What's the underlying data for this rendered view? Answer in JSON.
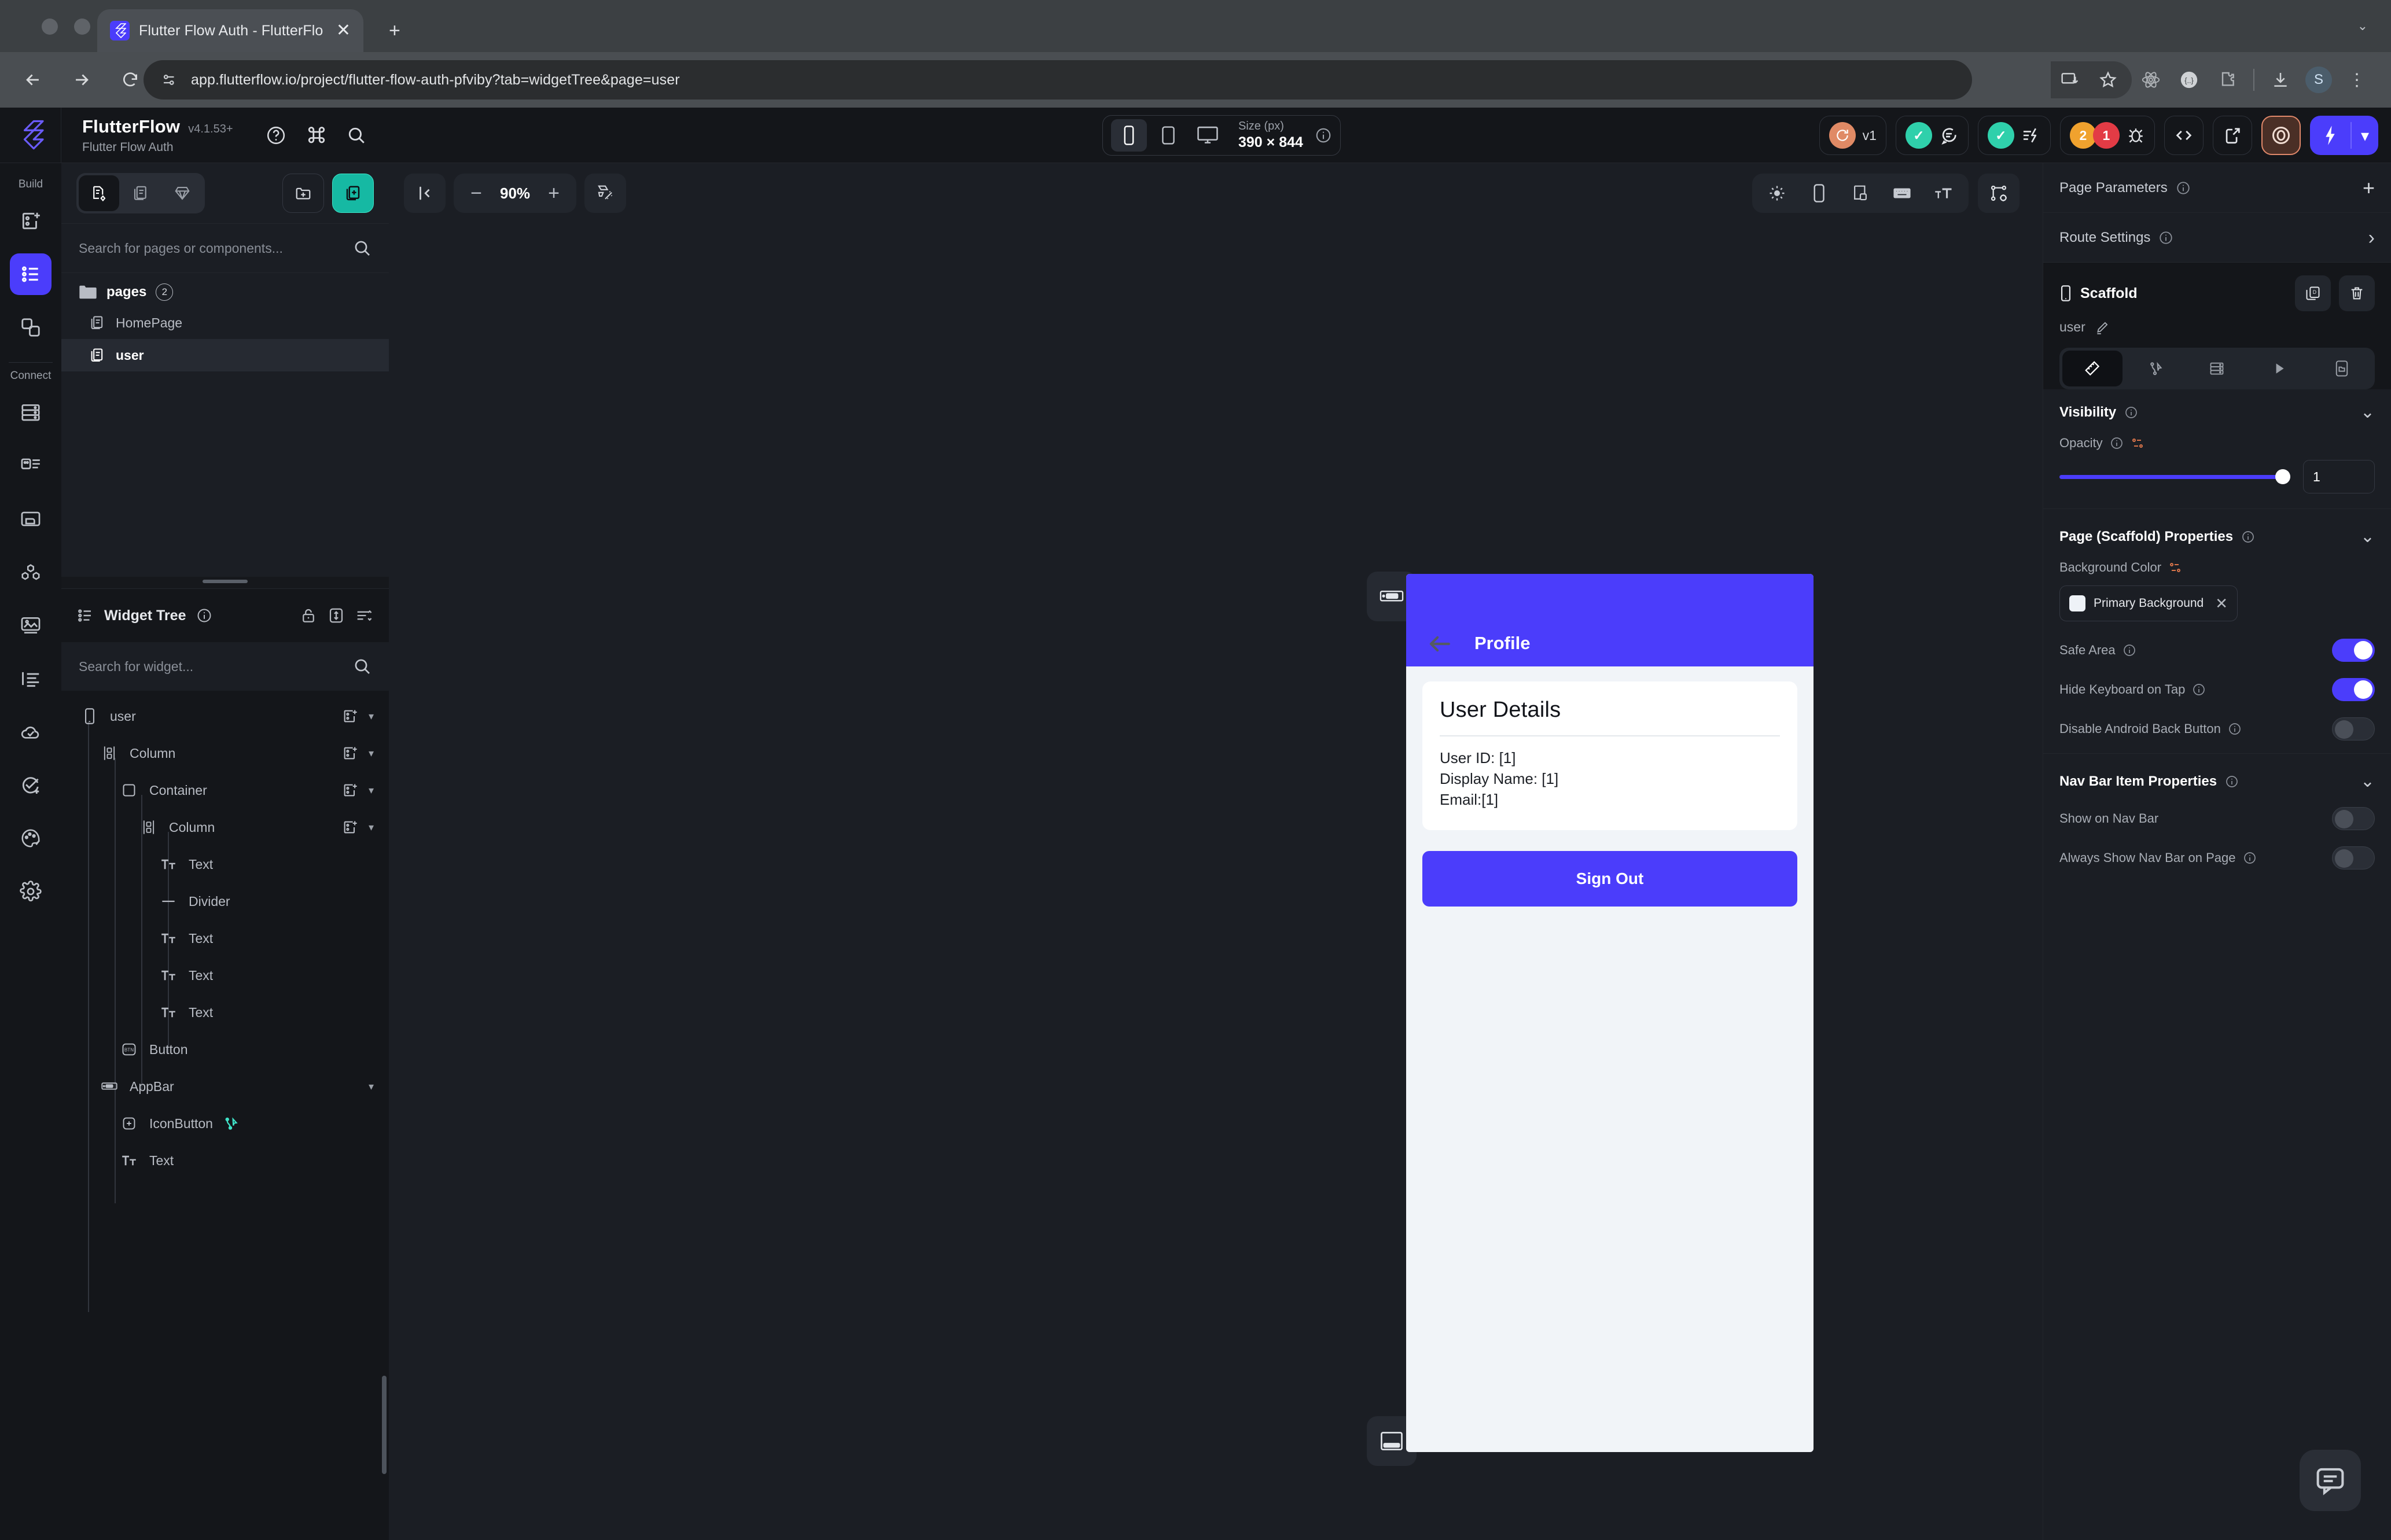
{
  "browser": {
    "tab": {
      "title": "Flutter Flow Auth - FlutterFlo",
      "favicon": "flutterflow-logo-icon",
      "close_label": "✕"
    },
    "new_tab_label": "+",
    "url": "app.flutterflow.io/project/flutter-flow-auth-pfviby?tab=widgetTree&page=user",
    "nav": {
      "back": "back-arrow",
      "forward": "forward-arrow",
      "reload": "reload-icon"
    },
    "toolbar_icons": [
      "install-app-icon",
      "bookmark-star-icon",
      "react-devtools-icon",
      "json-viewer-icon",
      "extension-icon",
      "downloads-icon"
    ],
    "profile_initial": "S",
    "menu_label": "⋮"
  },
  "ff_header": {
    "brand": "FlutterFlow",
    "version": "v4.1.53+",
    "project": "Flutter Flow Auth",
    "icons": [
      "help-circle-icon",
      "command-icon",
      "search-icon"
    ],
    "device_sizes": [
      {
        "name": "phone",
        "active": true
      },
      {
        "name": "tablet",
        "active": false
      },
      {
        "name": "desktop",
        "active": false
      }
    ],
    "size_label": "Size (px)",
    "size_value": "390 × 844",
    "right": {
      "version_badge": "v1",
      "comments_check": "✓",
      "issues_check": "✓",
      "warning_count": "2",
      "error_count": "1",
      "code_icon": "code-brackets-icon",
      "deploy_icon": "share-export-icon",
      "preview_icon": "eye-preview-icon",
      "run_icon": "lightning-run-icon",
      "run_chevron": "▾"
    },
    "accent": "#4b3dfb"
  },
  "rail": {
    "build_label": "Build",
    "connect_label": "Connect",
    "build_items": [
      {
        "name": "new-page-icon",
        "active": false
      },
      {
        "name": "widget-tree-icon",
        "active": true
      },
      {
        "name": "components-icon",
        "active": false
      }
    ],
    "connect_items": [
      {
        "name": "database-icon"
      },
      {
        "name": "app-state-icon"
      },
      {
        "name": "media-folder-icon"
      },
      {
        "name": "api-integrations-icon"
      },
      {
        "name": "assets-image-icon"
      },
      {
        "name": "localization-icon"
      },
      {
        "name": "cloud-functions-icon"
      },
      {
        "name": "tests-icon"
      },
      {
        "name": "theme-palette-icon"
      },
      {
        "name": "settings-gear-icon"
      }
    ]
  },
  "pages_panel": {
    "segments": [
      {
        "name": "pages-and-components-tab",
        "active": true
      },
      {
        "name": "pages-tab",
        "active": false
      },
      {
        "name": "components-tab",
        "active": false
      }
    ],
    "new_folder_label": "new-folder-icon",
    "new_page_label": "add-page-icon",
    "search_placeholder": "Search for pages or components...",
    "folder": {
      "label": "pages",
      "count": "2"
    },
    "pages": [
      {
        "label": "HomePage",
        "selected": false
      },
      {
        "label": "user",
        "selected": true
      }
    ]
  },
  "widget_tree": {
    "title": "Widget Tree",
    "header_icons": [
      "lock-icon",
      "expand-vertical-icon",
      "sort-collapse-icon"
    ],
    "search_placeholder": "Search for widget...",
    "items": [
      {
        "label": "user",
        "icon": "phone-icon",
        "depth": 0,
        "has_add": true,
        "has_chevron": true
      },
      {
        "label": "Column",
        "icon": "column-icon",
        "depth": 1,
        "has_add": true,
        "has_chevron": true
      },
      {
        "label": "Container",
        "icon": "container-icon",
        "depth": 2,
        "has_add": true,
        "has_chevron": true
      },
      {
        "label": "Column",
        "icon": "column-icon",
        "depth": 3,
        "has_add": true,
        "has_chevron": true
      },
      {
        "label": "Text",
        "icon": "text-icon",
        "depth": 4,
        "has_add": false,
        "has_chevron": false
      },
      {
        "label": "Divider",
        "icon": "divider-icon",
        "depth": 4,
        "has_add": false,
        "has_chevron": false
      },
      {
        "label": "Text",
        "icon": "text-icon",
        "depth": 4,
        "has_add": false,
        "has_chevron": false
      },
      {
        "label": "Text",
        "icon": "text-icon",
        "depth": 4,
        "has_add": false,
        "has_chevron": false
      },
      {
        "label": "Text",
        "icon": "text-icon",
        "depth": 4,
        "has_add": false,
        "has_chevron": false
      },
      {
        "label": "Button",
        "icon": "button-icon",
        "depth": 2,
        "has_add": false,
        "has_chevron": false
      },
      {
        "label": "AppBar",
        "icon": "appbar-icon",
        "depth": 1,
        "has_add": false,
        "has_chevron": true
      },
      {
        "label": "IconButton",
        "icon": "icon-button-icon",
        "depth": 2,
        "has_add": false,
        "has_chevron": false,
        "has_action": true
      },
      {
        "label": "Text",
        "icon": "text-icon",
        "depth": 2,
        "has_add": false,
        "has_chevron": false
      }
    ]
  },
  "canvas": {
    "collapse_icon": "collapse-left-icon",
    "zoom_out": "−",
    "zoom_value": "90%",
    "zoom_in": "+",
    "magic_icon": "magic-wand-icon",
    "right_tools": [
      "theme-sun-icon",
      "device-phone-icon",
      "split-view-icon",
      "keyboard-icon",
      "text-size-icon"
    ],
    "widget_settings_icon": "widget-palette-icon",
    "badges": [
      "appbar-badge-icon",
      "bottom-bar-badge-icon"
    ],
    "preview": {
      "appbar_title": "Profile",
      "back_icon": "back-arrow-icon",
      "card_title": "User Details",
      "lines": [
        "User ID: [1]",
        "Display Name: [1]",
        "Email:[1]"
      ],
      "button_label": "Sign Out",
      "appbar_color": "#4b3dfb",
      "bg_color": "#f1f4f8"
    }
  },
  "right_panel": {
    "page_parameters": {
      "label": "Page Parameters",
      "add": "+"
    },
    "route_settings": {
      "label": "Route Settings",
      "chevron": "›"
    },
    "selected": {
      "type": "Scaffold",
      "name": "user",
      "edit_icon": "pencil-edit-icon",
      "duplicate_icon": "duplicate-icon",
      "delete_icon": "trash-icon"
    },
    "tabs": [
      {
        "name": "properties-tab",
        "icon": "ruler-pencil-icon",
        "active": true
      },
      {
        "name": "actions-tab",
        "icon": "actions-flow-icon",
        "active": false
      },
      {
        "name": "backend-query-tab",
        "icon": "database-icon",
        "active": false
      },
      {
        "name": "animations-tab",
        "icon": "play-icon",
        "active": false
      },
      {
        "name": "page-state-tab",
        "icon": "page-state-icon",
        "active": false
      }
    ],
    "visibility": {
      "title": "Visibility",
      "opacity_label": "Opacity",
      "opacity_value": "1",
      "opacity_percent": 100,
      "chevron": "⌄"
    },
    "scaffold_props": {
      "title": "Page (Scaffold) Properties",
      "chevron": "⌄",
      "background_color_label": "Background Color",
      "background_color_value": "Primary Background",
      "background_swatch": "#eef2f7",
      "toggles": [
        {
          "label": "Safe Area",
          "on": true,
          "info": true
        },
        {
          "label": "Hide Keyboard on Tap",
          "on": true,
          "info": true
        },
        {
          "label": "Disable Android Back Button",
          "on": false,
          "info": true
        }
      ]
    },
    "navbar_props": {
      "title": "Nav Bar Item Properties",
      "chevron": "⌄",
      "toggles": [
        {
          "label": "Show on Nav Bar",
          "on": false,
          "info": false
        },
        {
          "label": "Always Show Nav Bar on Page",
          "on": false,
          "info": true
        }
      ]
    }
  },
  "intercom": {
    "icon": "chat-bubble-icon"
  }
}
